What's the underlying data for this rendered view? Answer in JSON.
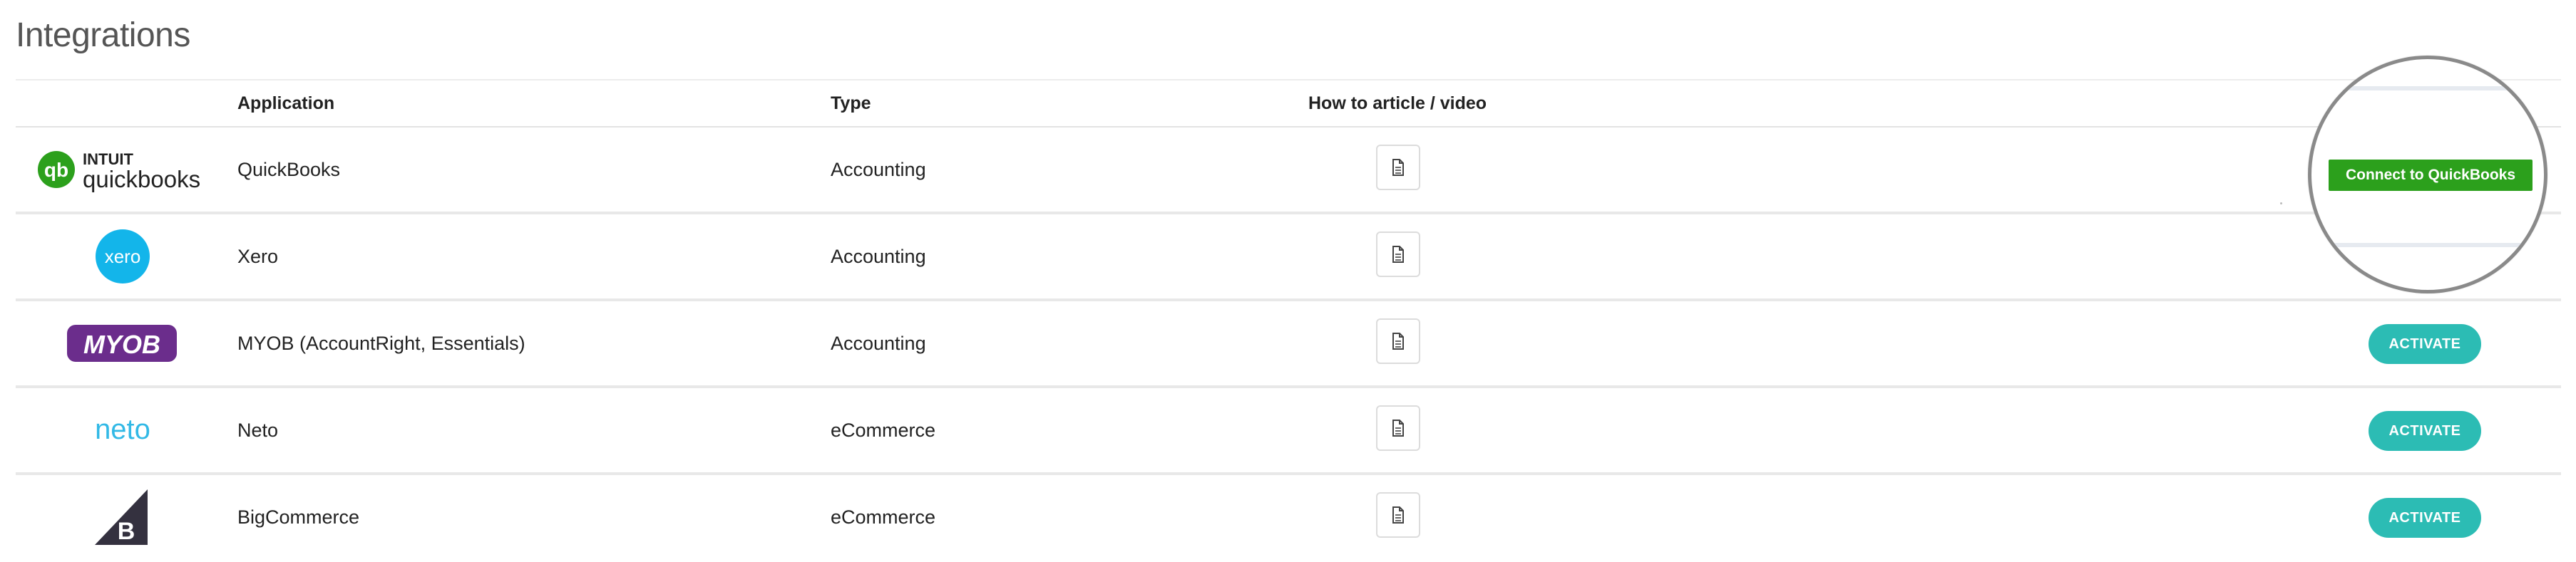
{
  "page": {
    "title": "Integrations"
  },
  "table": {
    "headers": {
      "application": "Application",
      "type": "Type",
      "howto": "How to article / video"
    },
    "rows": [
      {
        "logo": "quickbooks",
        "logo_text_top": "INTUIT",
        "logo_text_bottom": "quickbooks",
        "application": "QuickBooks",
        "type": "Accounting",
        "action": "Connect to QuickBooks",
        "action_kind": "quickbooks-connect"
      },
      {
        "logo": "xero",
        "logo_text": "xero",
        "application": "Xero",
        "type": "Accounting",
        "action": "",
        "action_kind": "none"
      },
      {
        "logo": "myob",
        "logo_text": "MYOB",
        "application": "MYOB (AccountRight, Essentials)",
        "type": "Accounting",
        "action": "ACTIVATE",
        "action_kind": "activate"
      },
      {
        "logo": "neto",
        "logo_text": "neto",
        "application": "Neto",
        "type": "eCommerce",
        "action": "ACTIVATE",
        "action_kind": "activate"
      },
      {
        "logo": "bigcommerce",
        "logo_text": "B",
        "application": "BigCommerce",
        "type": "eCommerce",
        "action": "ACTIVATE",
        "action_kind": "activate"
      }
    ]
  },
  "colors": {
    "activate": "#2cbcb4",
    "quickbooks_green": "#2ca01c",
    "xero_blue": "#13b5ea",
    "myob_purple": "#6b2d8c",
    "neto_blue": "#32b9e6"
  },
  "icons": {
    "howto": "document-icon"
  }
}
